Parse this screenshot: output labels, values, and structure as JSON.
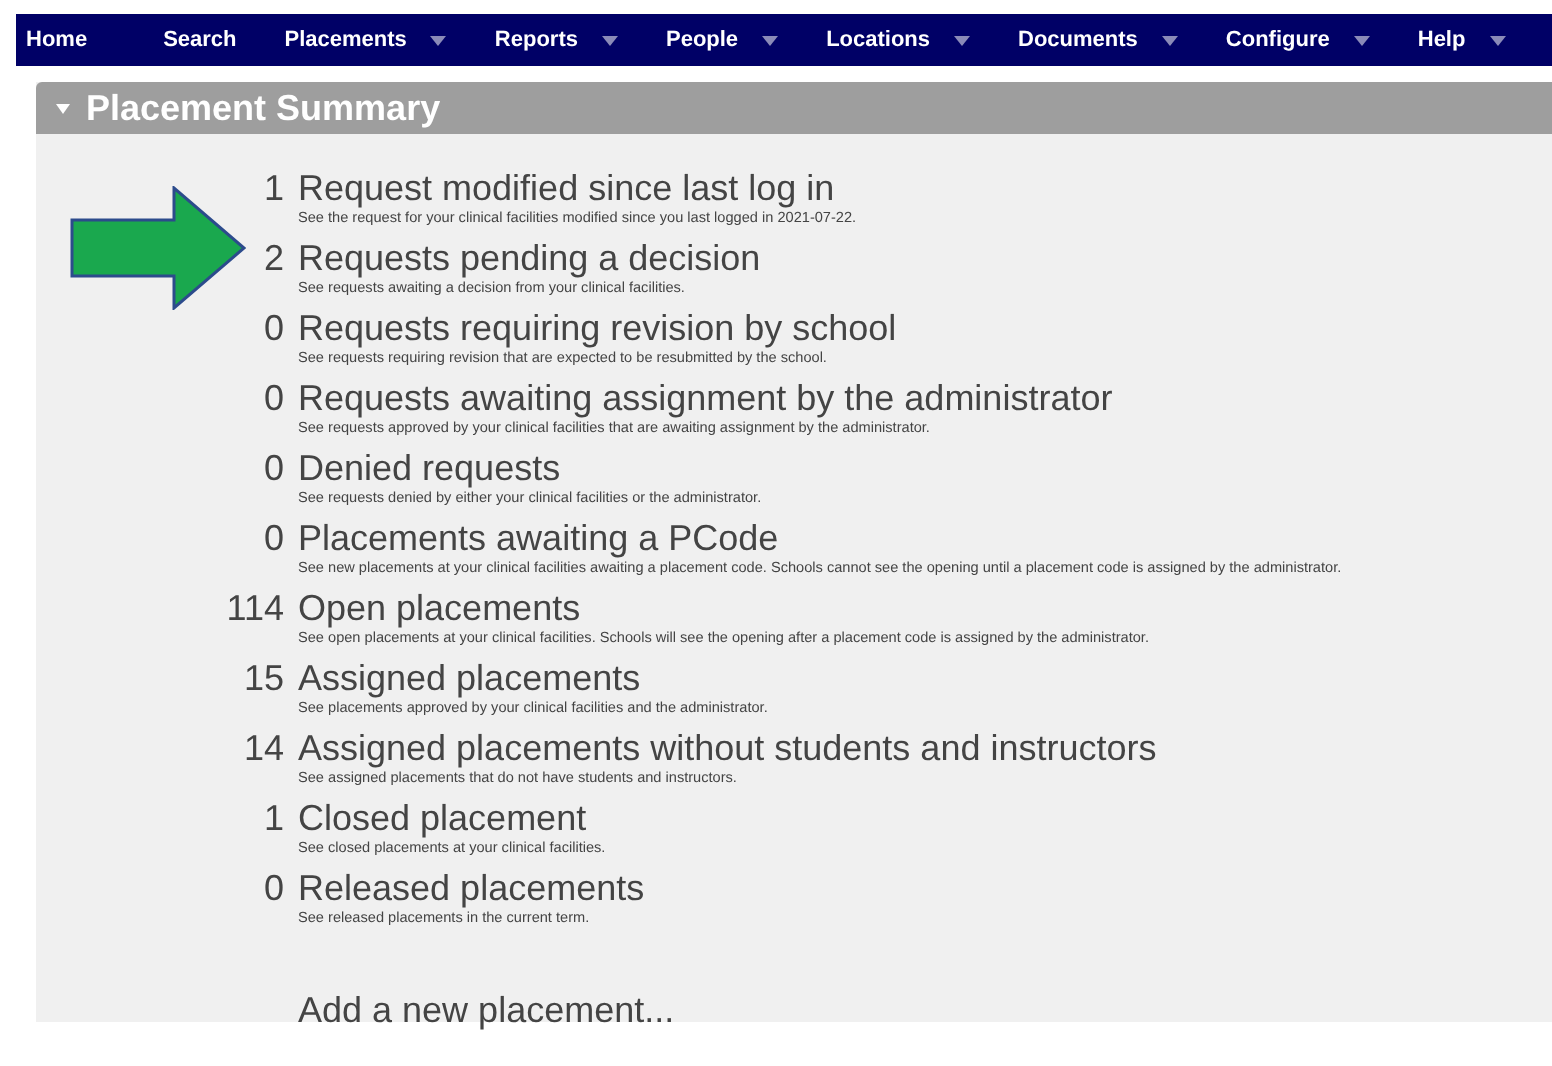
{
  "nav": [
    {
      "label": "Home",
      "dropdown": false
    },
    {
      "label": "Search",
      "dropdown": false
    },
    {
      "label": "Placements",
      "dropdown": true
    },
    {
      "label": "Reports",
      "dropdown": true
    },
    {
      "label": "People",
      "dropdown": true
    },
    {
      "label": "Locations",
      "dropdown": true
    },
    {
      "label": "Documents",
      "dropdown": true
    },
    {
      "label": "Configure",
      "dropdown": true
    },
    {
      "label": "Help",
      "dropdown": true
    }
  ],
  "panel": {
    "title": "Placement Summary",
    "expanded": true
  },
  "items": [
    {
      "count": "1",
      "title": "Request modified since last log in",
      "description": "See the request for your clinical facilities modified since you last logged in 2021-07-22."
    },
    {
      "count": "2",
      "title": "Requests pending a decision",
      "description": "See requests awaiting a decision from your clinical facilities."
    },
    {
      "count": "0",
      "title": "Requests requiring revision by school",
      "description": "See requests requiring revision that are expected to be resubmitted by the school."
    },
    {
      "count": "0",
      "title": "Requests awaiting assignment by the administrator",
      "description": "See requests approved by your clinical facilities that are awaiting assignment by the administrator."
    },
    {
      "count": "0",
      "title": "Denied requests",
      "description": "See requests denied by either your clinical facilities or the administrator."
    },
    {
      "count": "0",
      "title": "Placements awaiting a PCode",
      "description": "See new placements at your clinical facilities awaiting a placement code. Schools cannot see the opening until a placement code is assigned by the administrator."
    },
    {
      "count": "114",
      "title": "Open placements",
      "description": "See open placements at your clinical facilities. Schools will see the opening after a placement code is assigned by the administrator."
    },
    {
      "count": "15",
      "title": "Assigned placements",
      "description": "See placements approved by your clinical facilities and the administrator."
    },
    {
      "count": "14",
      "title": "Assigned placements without students and instructors",
      "description": "See assigned placements that do not have students and instructors."
    },
    {
      "count": "1",
      "title": "Closed placement",
      "description": "See closed placements at your clinical facilities."
    },
    {
      "count": "0",
      "title": "Released placements",
      "description": "See released placements in the current term."
    }
  ],
  "add_link": "Add a new placement..."
}
